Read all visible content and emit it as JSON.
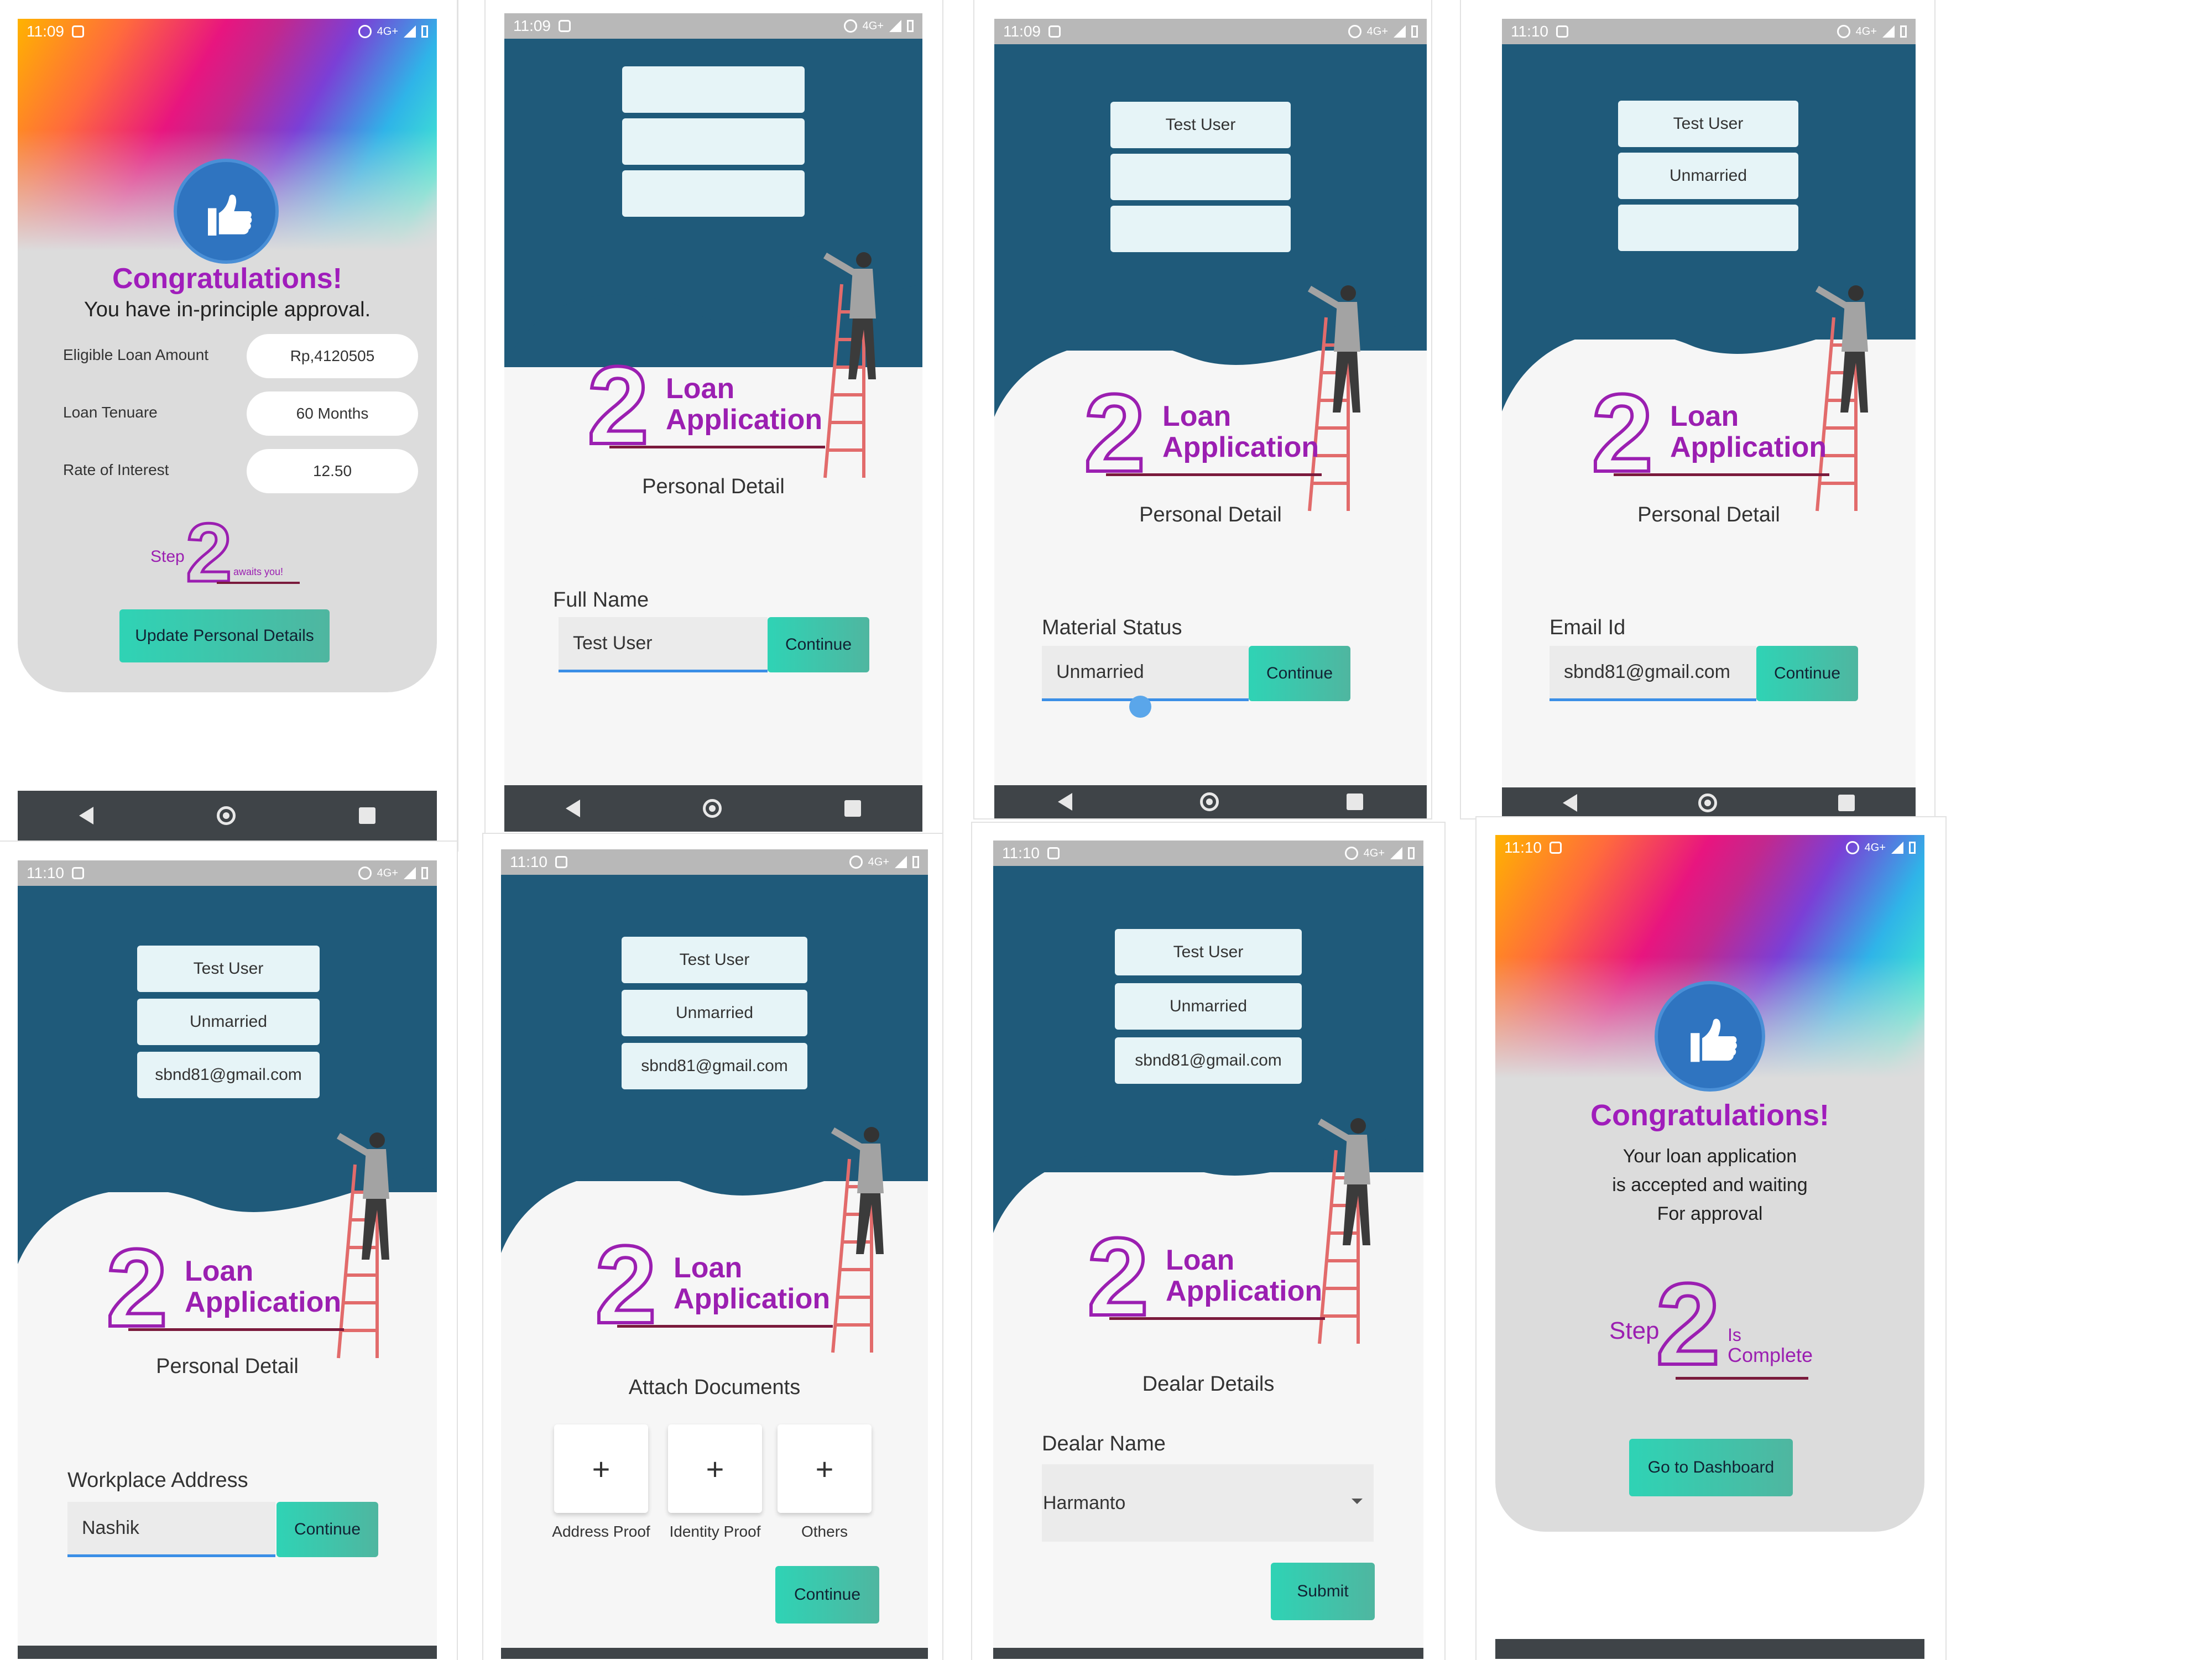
{
  "colors": {
    "brand_purple": "#9b1fb1",
    "header_blue": "#1f5a7a",
    "button_teal": "#2fd3b5",
    "input_underline": "#3a8ee6",
    "navbar": "#3f4448"
  },
  "common": {
    "logo_digit": "2",
    "logo_line1": "Loan",
    "logo_line2": "Application",
    "continue_label": "Continue",
    "net_label": "4G+"
  },
  "screens": [
    {
      "time": "11:09",
      "title": "Congratulations!",
      "message": "You have in-principle approval.",
      "rows": [
        {
          "label": "Eligible Loan Amount",
          "value": "Rp,4120505"
        },
        {
          "label": "Loan Tenuare",
          "value": "60 Months"
        },
        {
          "label": "Rate of Interest",
          "value": "12.50"
        }
      ],
      "step_word": "Step",
      "step_digit": "2",
      "step_tail": "awaits you!",
      "button": "Update Personal Details"
    },
    {
      "time": "11:09",
      "pills": [
        "",
        "",
        ""
      ],
      "subtitle": "Personal Detail",
      "field_label": "Full Name",
      "field_value": "Test User"
    },
    {
      "time": "11:09",
      "pills": [
        "Test User",
        "",
        ""
      ],
      "subtitle": "Personal Detail",
      "field_label": "Material Status",
      "field_value": "Unmarried"
    },
    {
      "time": "11:10",
      "pills": [
        "Test User",
        "Unmarried",
        ""
      ],
      "subtitle": "Personal Detail",
      "field_label": "Email Id",
      "field_value": "sbnd81@gmail.com"
    },
    {
      "time": "11:10",
      "pills": [
        "Test User",
        "Unmarried",
        "sbnd81@gmail.com"
      ],
      "subtitle": "Personal Detail",
      "field_label": "Workplace Address",
      "field_value": "Nashik"
    },
    {
      "time": "11:10",
      "pills": [
        "Test User",
        "Unmarried",
        "sbnd81@gmail.com"
      ],
      "subtitle": "Attach Documents",
      "docs": [
        {
          "icon": "+",
          "label": "Address Proof"
        },
        {
          "icon": "+",
          "label": "Identity Proof"
        },
        {
          "icon": "+",
          "label": "Others"
        }
      ]
    },
    {
      "time": "11:10",
      "pills": [
        "Test User",
        "Unmarried",
        "sbnd81@gmail.com"
      ],
      "subtitle": "Dealar Details",
      "field_label": "Dealar Name",
      "field_value": "Harmanto",
      "submit": "Submit"
    },
    {
      "time": "11:10",
      "title": "Congratulations!",
      "message_lines": [
        "Your loan application",
        "is accepted and waiting",
        "For approval"
      ],
      "step_word": "Step",
      "step_digit": "2",
      "step_tail_1": "Is",
      "step_tail_2": "Complete",
      "button": "Go to Dashboard"
    }
  ]
}
